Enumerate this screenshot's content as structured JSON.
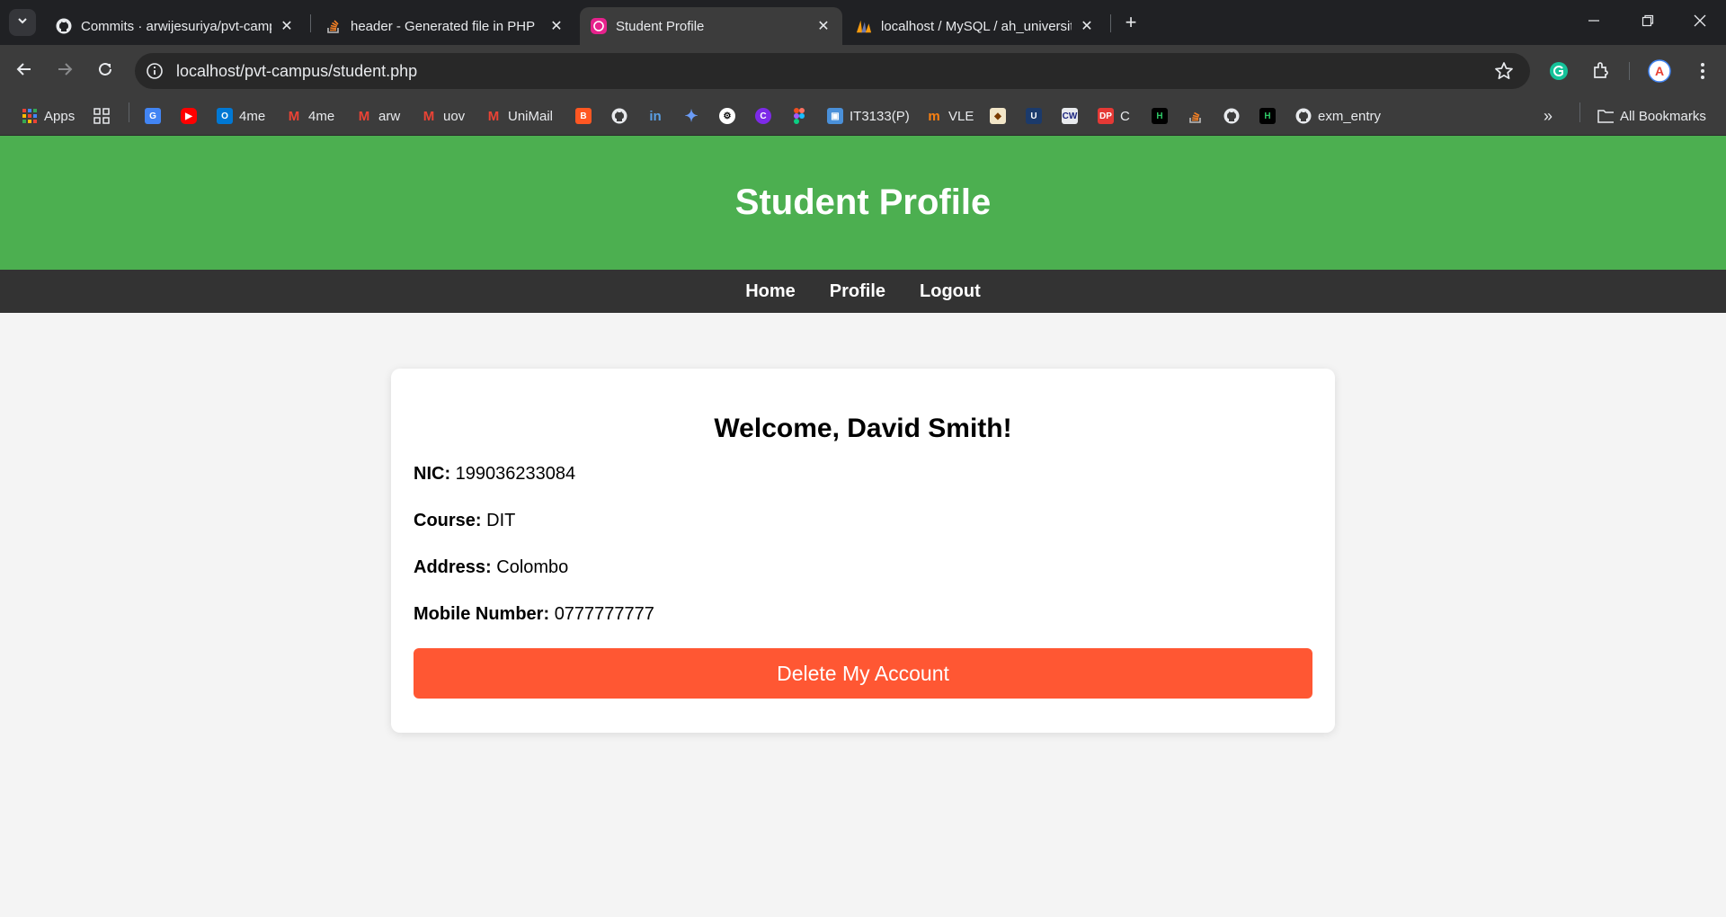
{
  "browser": {
    "tabs": [
      {
        "title": "Commits · arwijesuriya/pvt-campus",
        "icon": "github-icon"
      },
      {
        "title": "header - Generated file in PHP",
        "icon": "stackoverflow-icon"
      },
      {
        "title": "Student Profile",
        "icon": "app-icon",
        "active": true
      },
      {
        "title": "localhost / MySQL / ah_university",
        "icon": "phpmyadmin-icon"
      }
    ],
    "url": "localhost/pvt-campus/student.php",
    "bookmarks": {
      "apps": "Apps",
      "outlook_4me": "4me",
      "gmail_4me": "4me",
      "gmail_arw": "arw",
      "gmail_uov": "uov",
      "gmail_unimail": "UniMail",
      "it3133": "IT3133(P)",
      "vle": "VLE",
      "dp_c": "C",
      "exm_entry": "exm_entry",
      "all_bookmarks": "All Bookmarks"
    }
  },
  "page": {
    "title": "Student Profile",
    "nav": {
      "home": "Home",
      "profile": "Profile",
      "logout": "Logout"
    },
    "card": {
      "welcome": "Welcome, David Smith!",
      "nic_label": "NIC:",
      "nic_value": "199036233084",
      "course_label": "Course:",
      "course_value": "DIT",
      "address_label": "Address:",
      "address_value": "Colombo",
      "mobile_label": "Mobile Number:",
      "mobile_value": "0777777777",
      "delete_button": "Delete My Account"
    }
  },
  "colors": {
    "header_bg": "#4caf50",
    "nav_bg": "#333333",
    "delete_button": "#ff5733"
  }
}
